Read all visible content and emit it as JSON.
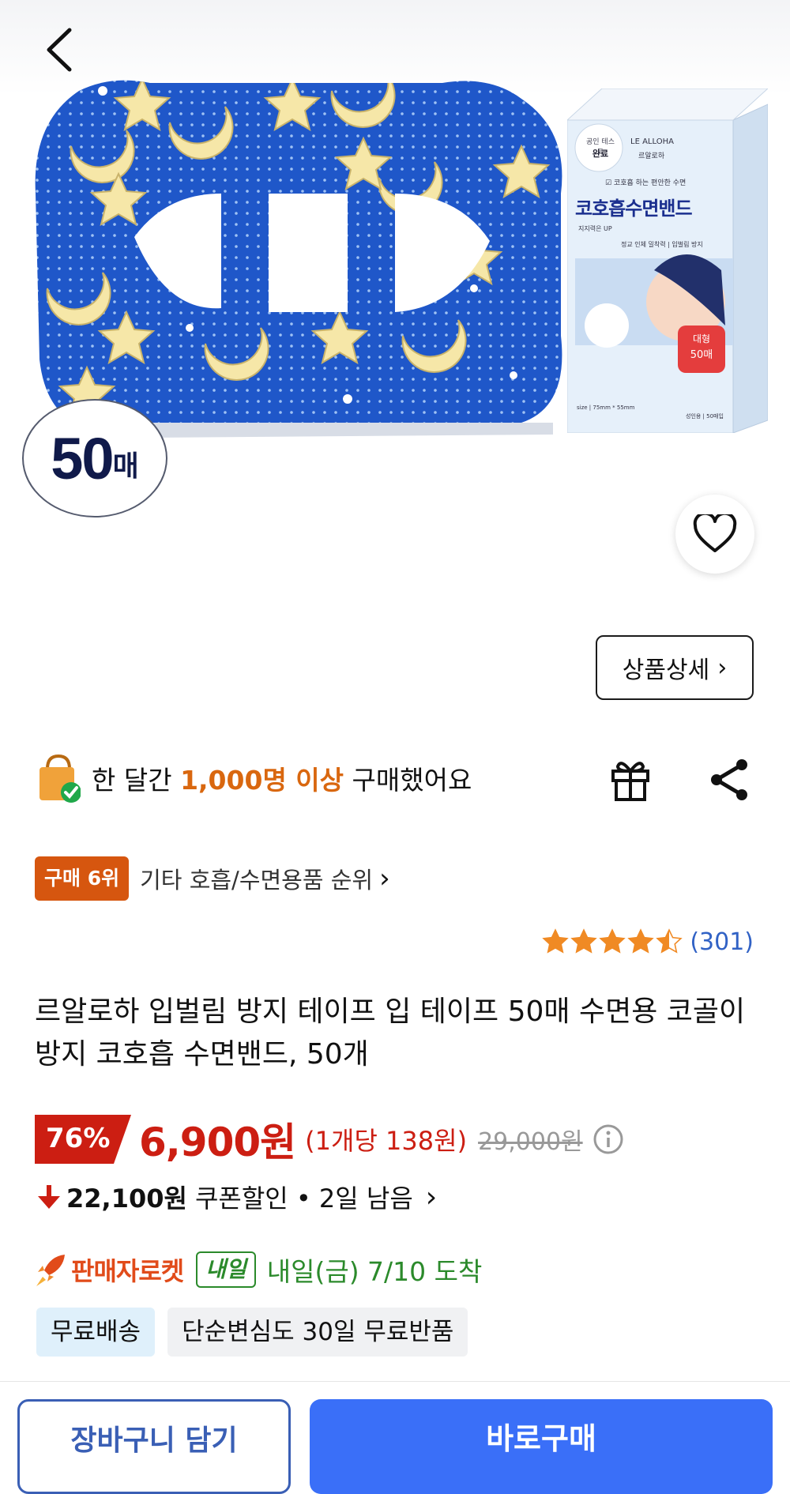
{
  "hero": {
    "count_number": "50",
    "count_unit": "매",
    "box": {
      "test_label": "공인 테스트",
      "test_done": "완료",
      "brand_en": "LE ALLOHA",
      "brand_ko": "르알로하",
      "tagline": "☑ 코호흡 하는 편안한 수면",
      "product_name": "코호흡수면밴드",
      "sub": "지지력은 UP",
      "sub2": "정교 인체 밀착력 | 입벌림 방지",
      "large_tag": "대형",
      "large_count": "50매",
      "size": "size | 75mm * 55mm",
      "qty": "성인용 | 50매입"
    }
  },
  "gallery": {
    "total_dots": 10,
    "active_index": 0,
    "detail_label": "상품상세"
  },
  "purchase": {
    "pre": "한 달간 ",
    "highlight": "1,000명 이상",
    "post": " 구매했어요"
  },
  "rank": {
    "badge": "구매 6위",
    "text": "기타 호흡/수면용품 순위"
  },
  "rating": {
    "stars": 4.5,
    "count": "(301)"
  },
  "product": {
    "title": "르알로하 입벌림 방지 테이프 입 테이프 50매 수면용 코골이방지 코호흡 수면밴드, 50개"
  },
  "price": {
    "discount": "76%",
    "sale": "6,900원",
    "unit": "(1개당 138원)",
    "original": "29,000원"
  },
  "coupon": {
    "amount": "22,100원",
    "text": "쿠폰할인 • 2일 남음"
  },
  "delivery": {
    "rocket": "판매자로켓",
    "tomorrow": "내일",
    "arrival": "내일(금) 7/10 도착"
  },
  "tags": [
    "무료배송",
    "단순변심도 30일 무료반품"
  ],
  "bottom": {
    "cart": "장바구니 담기",
    "buy": "바로구매"
  },
  "colors": {
    "accent_blue": "#3a6ff8",
    "price_red": "#cc1e12",
    "rank_orange": "#d6560f",
    "delivery_green": "#2b8a2b",
    "rating_blue": "#3162c5"
  }
}
